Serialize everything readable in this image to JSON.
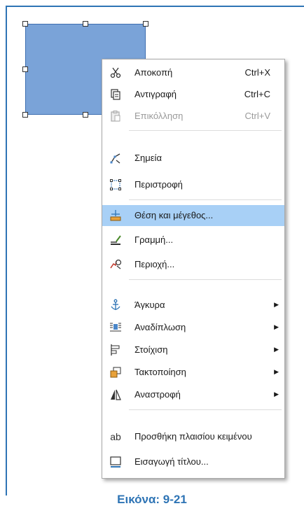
{
  "menu": {
    "items": [
      {
        "icon": "scissors-icon",
        "label": "Αποκοπή",
        "shortcut": "Ctrl+X"
      },
      {
        "icon": "copy-icon",
        "label": "Αντιγραφή",
        "shortcut": "Ctrl+C"
      },
      {
        "icon": "paste-icon",
        "label": "Επικόλληση",
        "shortcut": "Ctrl+V"
      },
      {
        "icon": "points-icon",
        "label": "Σημεία"
      },
      {
        "icon": "rotate-icon",
        "label": "Περιστροφή"
      },
      {
        "icon": "position-size-icon",
        "label": "Θέση και μέγεθος..."
      },
      {
        "icon": "line-icon",
        "label": "Γραμμή..."
      },
      {
        "icon": "area-icon",
        "label": "Περιοχή..."
      },
      {
        "icon": "anchor-icon",
        "label": "Άγκυρα"
      },
      {
        "icon": "wrap-icon",
        "label": "Αναδίπλωση"
      },
      {
        "icon": "align-icon",
        "label": "Στοίχιση"
      },
      {
        "icon": "arrange-icon",
        "label": "Τακτοποίηση"
      },
      {
        "icon": "flip-icon",
        "label": "Αναστροφή"
      },
      {
        "icon": "text-box-icon",
        "label": "Προσθήκη πλαισίου κειμένου"
      },
      {
        "icon": "caption-icon",
        "label": "Εισαγωγή τίτλου..."
      }
    ],
    "highlight_color": "#a8d0f6",
    "disabled_item": "Επικόλληση"
  },
  "caption": "Εικόνα: 9-21",
  "colors": {
    "accent": "#2e74b5",
    "shape_fill": "#7aa3d8"
  }
}
